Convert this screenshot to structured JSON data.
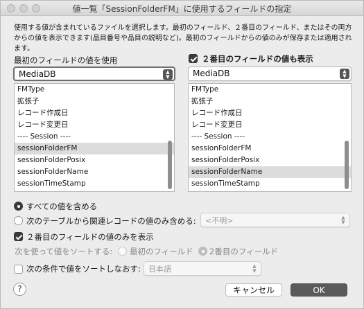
{
  "window": {
    "title": "値一覧「SessionFolderFM」に使用するフィールドの指定"
  },
  "description": "使用する値が含まれているファイルを選択します。最初のフィールド、２番目のフィールド、またはその両方からの値を表示できます(品目番号や品目の説明など)。最初のフィールドからの値のみが保存または適用されます。",
  "left_column": {
    "label": "最初のフィールドの値を使用",
    "table_popup": "MediaDB",
    "fields": [
      {
        "label": "FMType",
        "selected": false
      },
      {
        "label": "拡張子",
        "selected": false
      },
      {
        "label": "レコード作成日",
        "selected": false
      },
      {
        "label": "レコード変更日",
        "selected": false
      },
      {
        "label": "---- Session ----",
        "selected": false
      },
      {
        "label": "sessionFolderFM",
        "selected": true
      },
      {
        "label": "sessionFolderPosix",
        "selected": false
      },
      {
        "label": "sessionFolderName",
        "selected": false
      },
      {
        "label": "sessionTimeStamp",
        "selected": false
      }
    ]
  },
  "right_column": {
    "checkbox_label": "２番目のフィールドの値も表示",
    "checkbox_checked": true,
    "table_popup": "MediaDB",
    "fields": [
      {
        "label": "FMType",
        "selected": false
      },
      {
        "label": "拡張子",
        "selected": false
      },
      {
        "label": "レコード作成日",
        "selected": false
      },
      {
        "label": "レコード変更日",
        "selected": false
      },
      {
        "label": "---- Session ----",
        "selected": false
      },
      {
        "label": "sessionFolderFM",
        "selected": false
      },
      {
        "label": "sessionFolderPosix",
        "selected": false
      },
      {
        "label": "sessionFolderName",
        "selected": true
      },
      {
        "label": "sessionTimeStamp",
        "selected": false
      }
    ]
  },
  "options": {
    "include_all_label": "すべての値を含める",
    "include_related_label": "次のテーブルから関連レコードの値のみ含める:",
    "related_popup": "<不明>",
    "show_second_only_label": "２番目のフィールドの値のみを表示",
    "sort_by_label": "次を使って値をソートする:",
    "sort_first_label": "最初のフィールド",
    "sort_second_label": "2番目のフィールド",
    "resort_label": "次の条件で値をソートしなおす:",
    "language_popup": "日本語"
  },
  "buttons": {
    "help": "?",
    "cancel": "キャンセル",
    "ok": "OK"
  }
}
